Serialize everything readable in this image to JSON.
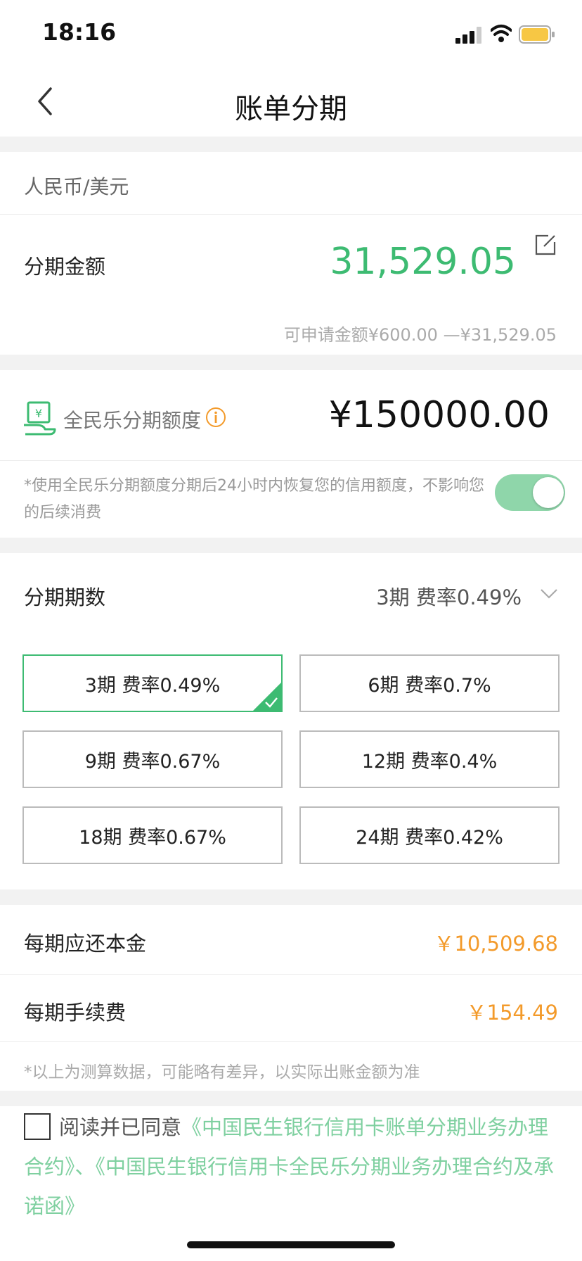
{
  "status_bar": {
    "time": "18:16"
  },
  "nav": {
    "title": "账单分期"
  },
  "currency": {
    "label": "人民币/美元"
  },
  "installment_amount": {
    "label": "分期金额",
    "value": "31,529.05",
    "range": "可申请金额¥600.00 —¥31,529.05"
  },
  "quota": {
    "label": "全民乐分期额度",
    "value": "¥150000.00",
    "note": "*使用全民乐分期额度分期后24小时内恢复您的信用额度，不影响您的后续消费",
    "toggle_on": true
  },
  "periods": {
    "label": "分期期数",
    "selected": "3期  费率0.49%",
    "options": [
      {
        "label": "3期  费率0.49%",
        "selected": true
      },
      {
        "label": "6期  费率0.7%",
        "selected": false
      },
      {
        "label": "9期  费率0.67%",
        "selected": false
      },
      {
        "label": "12期  费率0.4%",
        "selected": false
      },
      {
        "label": "18期  费率0.67%",
        "selected": false
      },
      {
        "label": "24期  费率0.42%",
        "selected": false
      }
    ]
  },
  "per_period_principal": {
    "label": "每期应还本金",
    "value": "￥10,509.68"
  },
  "per_period_fee": {
    "label": "每期手续费",
    "value": "￥154.49"
  },
  "disclaimer": "*以上为测算数据，可能略有差异，以实际出账金额为准",
  "agreement": {
    "prefix": "阅读并已同意",
    "link1": "《中国民生银行信用卡账单分期业务办理合约》",
    "separator": "、",
    "link2": "《中国民生银行信用卡全民乐分期业务办理合约及承诺函》"
  },
  "colors": {
    "accent": "#3dbb72",
    "amount_orange": "#f39a2a"
  }
}
